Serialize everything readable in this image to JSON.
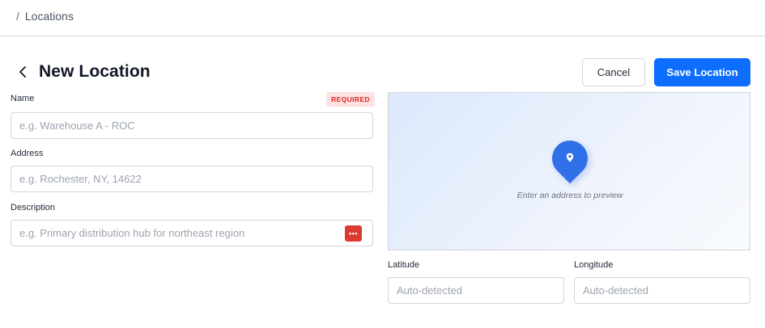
{
  "breadcrumb": {
    "separator": "/",
    "current": "Locations"
  },
  "header": {
    "title": "New Location",
    "cancel_label": "Cancel",
    "save_label": "Save Location"
  },
  "form": {
    "name": {
      "label": "Name",
      "badge": "REQUIRED",
      "placeholder": "e.g. Warehouse A - ROC",
      "value": ""
    },
    "address": {
      "label": "Address",
      "placeholder": "e.g. Rochester, NY, 14622",
      "value": ""
    },
    "description": {
      "label": "Description",
      "placeholder": "e.g. Primary distribution hub for northeast region",
      "value": "",
      "action_icon": "more-dots-icon",
      "action_glyph": "•••"
    }
  },
  "map": {
    "hint": "Enter an address to preview",
    "pin_icon": "map-pin-icon"
  },
  "coordinates": {
    "latitude": {
      "label": "Latitude",
      "placeholder": "Auto-detected",
      "value": ""
    },
    "longitude": {
      "label": "Longitude",
      "placeholder": "Auto-detected",
      "value": ""
    }
  },
  "colors": {
    "primary": "#0d6efd",
    "pin": "#2f6fe8",
    "required_badge_bg": "#fde2e2",
    "required_badge_text": "#dc2626",
    "dots_button": "#dc3b32"
  }
}
